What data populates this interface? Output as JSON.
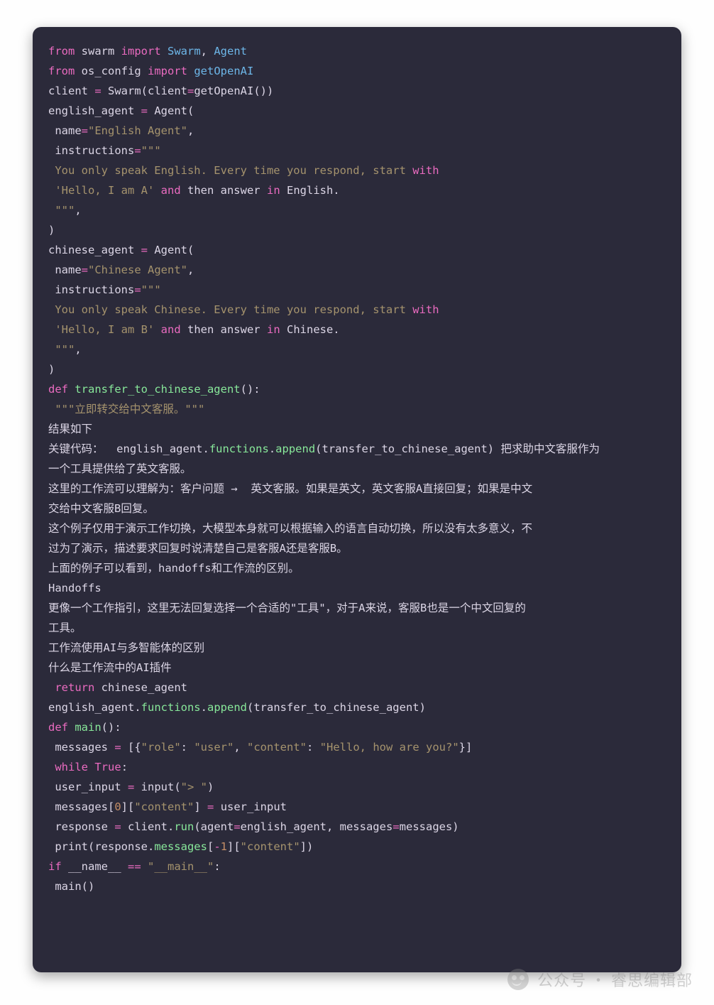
{
  "watermark": {
    "label": "公众号",
    "sep": "·",
    "name": "睿思编辑部"
  },
  "lines": [
    [
      [
        "kw",
        "from"
      ],
      [
        "wh",
        " swarm "
      ],
      [
        "kw",
        "import"
      ],
      [
        "wh",
        " "
      ],
      [
        "nm",
        "Swarm"
      ],
      [
        "wh",
        ", "
      ],
      [
        "nm",
        "Agent"
      ]
    ],
    [
      [
        "kw",
        "from"
      ],
      [
        "wh",
        " os_config "
      ],
      [
        "kw",
        "import"
      ],
      [
        "wh",
        " "
      ],
      [
        "nm",
        "getOpenAI"
      ]
    ],
    [
      [
        "wh",
        "client "
      ],
      [
        "op",
        "="
      ],
      [
        "wh",
        " Swarm(client"
      ],
      [
        "op",
        "="
      ],
      [
        "wh",
        "getOpenAI())"
      ]
    ],
    [
      [
        "wh",
        "english_agent "
      ],
      [
        "op",
        "="
      ],
      [
        "wh",
        " Agent("
      ]
    ],
    [
      [
        "wh",
        " name"
      ],
      [
        "op",
        "="
      ],
      [
        "st",
        "\"English Agent\""
      ],
      [
        "wh",
        ","
      ]
    ],
    [
      [
        "wh",
        " instructions"
      ],
      [
        "op",
        "="
      ],
      [
        "st",
        "\"\"\""
      ]
    ],
    [
      [
        "st",
        " You only speak English. Every time you respond, start "
      ],
      [
        "kw",
        "with"
      ]
    ],
    [
      [
        "st",
        " 'Hello, I am A'"
      ],
      [
        "wh",
        " "
      ],
      [
        "kw",
        "and"
      ],
      [
        "wh",
        " then answer "
      ],
      [
        "kw",
        "in"
      ],
      [
        "wh",
        " English."
      ]
    ],
    [
      [
        "st",
        " \"\"\""
      ],
      [
        "wh",
        ","
      ]
    ],
    [
      [
        "wh",
        ")"
      ]
    ],
    [
      [
        "wh",
        "chinese_agent "
      ],
      [
        "op",
        "="
      ],
      [
        "wh",
        " Agent("
      ]
    ],
    [
      [
        "wh",
        " name"
      ],
      [
        "op",
        "="
      ],
      [
        "st",
        "\"Chinese Agent\""
      ],
      [
        "wh",
        ","
      ]
    ],
    [
      [
        "wh",
        " instructions"
      ],
      [
        "op",
        "="
      ],
      [
        "st",
        "\"\"\""
      ]
    ],
    [
      [
        "st",
        " You only speak Chinese. Every time you respond, start "
      ],
      [
        "kw",
        "with"
      ]
    ],
    [
      [
        "st",
        " 'Hello, I am B'"
      ],
      [
        "wh",
        " "
      ],
      [
        "kw",
        "and"
      ],
      [
        "wh",
        " then answer "
      ],
      [
        "kw",
        "in"
      ],
      [
        "wh",
        " Chinese."
      ]
    ],
    [
      [
        "st",
        " \"\"\""
      ],
      [
        "wh",
        ","
      ]
    ],
    [
      [
        "wh",
        ")"
      ]
    ],
    [
      [
        "kw",
        "def"
      ],
      [
        "wh",
        " "
      ],
      [
        "fn",
        "transfer_to_chinese_agent"
      ],
      [
        "wh",
        "():"
      ]
    ],
    [
      [
        "st",
        " \"\"\"立即转交给中文客服。\"\"\""
      ]
    ],
    [
      [
        "wh",
        "结果如下"
      ]
    ],
    [
      [
        "wh",
        "关键代码：  english_agent."
      ],
      [
        "fn",
        "functions"
      ],
      [
        "wh",
        "."
      ],
      [
        "fn",
        "append"
      ],
      [
        "wh",
        "(transfer_to_chinese_agent) 把求助中文客服作为"
      ]
    ],
    [
      [
        "wh",
        "一个工具提供给了英文客服。"
      ]
    ],
    [
      [
        "wh",
        "这里的工作流可以理解为：客户问题 →  英文客服。如果是英文，英文客服A直接回复；如果是中文"
      ]
    ],
    [
      [
        "wh",
        "交给中文客服B回复。"
      ]
    ],
    [
      [
        "wh",
        "这个例子仅用于演示工作切换，大模型本身就可以根据输入的语言自动切换，所以没有太多意义，不"
      ]
    ],
    [
      [
        "wh",
        "过为了演示，描述要求回复时说清楚自己是客服A还是客服B。"
      ]
    ],
    [
      [
        "wh",
        "上面的例子可以看到，handoffs和工作流的区别。"
      ]
    ],
    [
      [
        "wh",
        "Handoffs"
      ]
    ],
    [
      [
        "wh",
        "更像一个工作指引，这里无法回复选择一个合适的\"工具\"，对于A来说，客服B也是一个中文回复的"
      ]
    ],
    [
      [
        "wh",
        "工具。"
      ]
    ],
    [
      [
        "wh",
        "工作流使用AI与多智能体的区别"
      ]
    ],
    [
      [
        "wh",
        "什么是工作流中的AI插件"
      ]
    ],
    [
      [
        "wh",
        " "
      ],
      [
        "kw",
        "return"
      ],
      [
        "wh",
        " chinese_agent"
      ]
    ],
    [
      [
        "wh",
        "english_agent."
      ],
      [
        "fn",
        "functions"
      ],
      [
        "wh",
        "."
      ],
      [
        "fn",
        "append"
      ],
      [
        "wh",
        "(transfer_to_chinese_agent)"
      ]
    ],
    [
      [
        "kw",
        "def"
      ],
      [
        "wh",
        " "
      ],
      [
        "fn",
        "main"
      ],
      [
        "wh",
        "():"
      ]
    ],
    [
      [
        "wh",
        " messages "
      ],
      [
        "op",
        "="
      ],
      [
        "wh",
        " [{"
      ],
      [
        "st",
        "\"role\""
      ],
      [
        "wh",
        ": "
      ],
      [
        "st",
        "\"user\""
      ],
      [
        "wh",
        ", "
      ],
      [
        "st",
        "\"content\""
      ],
      [
        "wh",
        ": "
      ],
      [
        "st",
        "\"Hello, how are you?\""
      ],
      [
        "wh",
        "}]"
      ]
    ],
    [
      [
        "wh",
        " "
      ],
      [
        "kw",
        "while"
      ],
      [
        "wh",
        " "
      ],
      [
        "kw",
        "True"
      ],
      [
        "wh",
        ":"
      ]
    ],
    [
      [
        "wh",
        " user_input "
      ],
      [
        "op",
        "="
      ],
      [
        "wh",
        " input("
      ],
      [
        "st",
        "\"> \""
      ],
      [
        "wh",
        ")"
      ]
    ],
    [
      [
        "wh",
        " messages["
      ],
      [
        "nu",
        "0"
      ],
      [
        "wh",
        "]["
      ],
      [
        "st",
        "\"content\""
      ],
      [
        "wh",
        "] "
      ],
      [
        "op",
        "="
      ],
      [
        "wh",
        " user_input"
      ]
    ],
    [
      [
        "wh",
        " response "
      ],
      [
        "op",
        "="
      ],
      [
        "wh",
        " client."
      ],
      [
        "fn",
        "run"
      ],
      [
        "wh",
        "(agent"
      ],
      [
        "op",
        "="
      ],
      [
        "wh",
        "english_agent, messages"
      ],
      [
        "op",
        "="
      ],
      [
        "wh",
        "messages)"
      ]
    ],
    [
      [
        "wh",
        " print(response."
      ],
      [
        "fn",
        "messages"
      ],
      [
        "wh",
        "["
      ],
      [
        "op",
        "-"
      ],
      [
        "nu",
        "1"
      ],
      [
        "wh",
        "]["
      ],
      [
        "st",
        "\"content\""
      ],
      [
        "wh",
        "])"
      ]
    ],
    [
      [
        "kw",
        "if"
      ],
      [
        "wh",
        " __name__ "
      ],
      [
        "op",
        "=="
      ],
      [
        "wh",
        " "
      ],
      [
        "st",
        "\"__main__\""
      ],
      [
        "wh",
        ":"
      ]
    ],
    [
      [
        "wh",
        " main()"
      ]
    ]
  ]
}
